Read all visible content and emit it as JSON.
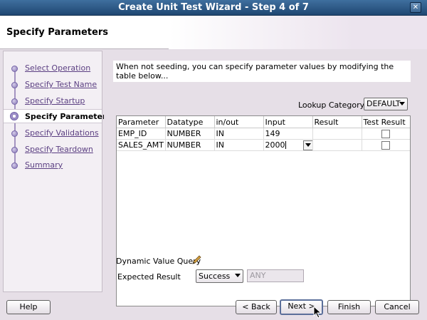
{
  "window": {
    "title": "Create Unit Test Wizard - Step 4 of 7"
  },
  "header": {
    "title": "Specify Parameters"
  },
  "steps": [
    {
      "label": "Select Operation",
      "current": false
    },
    {
      "label": "Specify Test Name",
      "current": false
    },
    {
      "label": "Specify Startup",
      "current": false
    },
    {
      "label": "Specify Parameters",
      "current": true
    },
    {
      "label": "Specify Validations",
      "current": false
    },
    {
      "label": "Specify Teardown",
      "current": false
    },
    {
      "label": "Summary",
      "current": false
    }
  ],
  "main": {
    "intro": "When not seeding, you can specify parameter values by modifying the table below...",
    "lookup_label": "Lookup Category",
    "lookup_value": "DEFAULT",
    "table": {
      "columns": [
        "Parameter",
        "Datatype",
        "in/out",
        "Input",
        "Result",
        "Test Result"
      ],
      "rows": [
        {
          "parameter": "EMP_ID",
          "datatype": "NUMBER",
          "inout": "IN",
          "input": "149",
          "result": "",
          "test_result": false
        },
        {
          "parameter": "SALES_AMT",
          "datatype": "NUMBER",
          "inout": "IN",
          "input": "2000",
          "result": "",
          "test_result": false
        }
      ]
    },
    "dynamic_value_query": "Dynamic Value Query",
    "expected_result_label": "Expected Result",
    "expected_result_value": "Success",
    "expected_result_text": "ANY"
  },
  "buttons": {
    "help": "Help",
    "back": "< Back",
    "next": "Next >",
    "finish": "Finish",
    "cancel": "Cancel"
  }
}
